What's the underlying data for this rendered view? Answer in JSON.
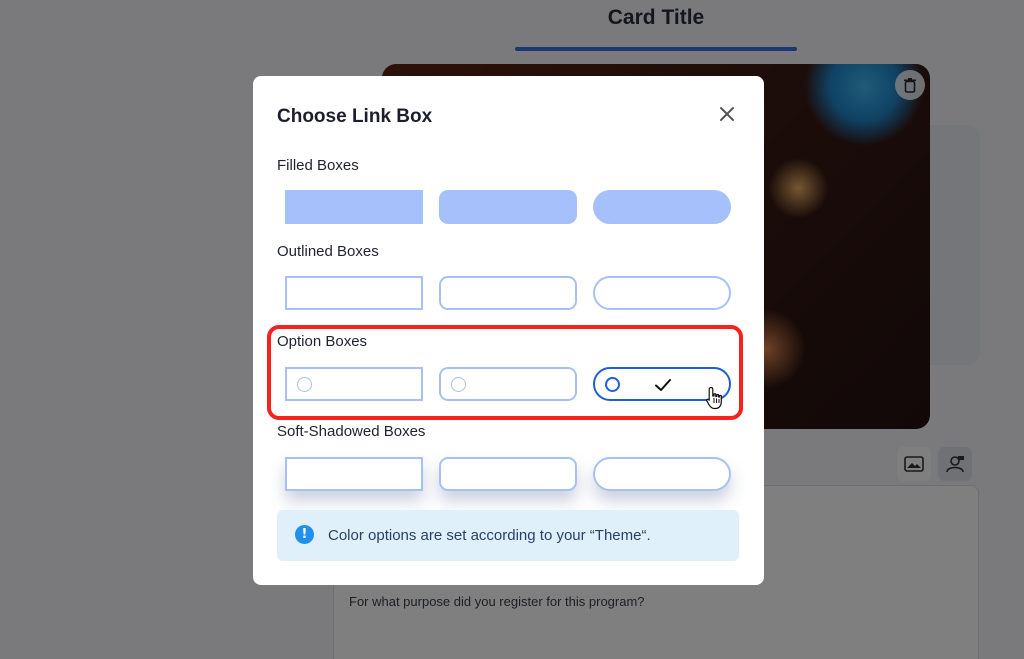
{
  "background": {
    "card_title": "Card Title",
    "form_question": "For what purpose did you register for this program?",
    "icons": [
      "trash-icon",
      "image-icon",
      "person-card-icon"
    ]
  },
  "modal": {
    "title": "Choose Link Box",
    "close_icon": "close-icon",
    "sections": {
      "filled": {
        "label": "Filled Boxes"
      },
      "outlined": {
        "label": "Outlined Boxes"
      },
      "option": {
        "label": "Option Boxes",
        "selected_index": 2
      },
      "soft": {
        "label": "Soft-Shadowed Boxes"
      }
    },
    "box_shapes": [
      "square",
      "rounded",
      "pill"
    ],
    "info": {
      "icon": "exclamation-info-icon",
      "text": "Color options are set according to your “Theme“."
    }
  },
  "colors": {
    "filled_box": "#a6c0fc",
    "outline": "#a8c1f4",
    "selected_outline": "#1e5fd6",
    "highlight": "#f5231b",
    "info_bg": "#dff0fb",
    "info_icon": "#1f8ff0",
    "tab_underline": "#3b6fe8"
  }
}
